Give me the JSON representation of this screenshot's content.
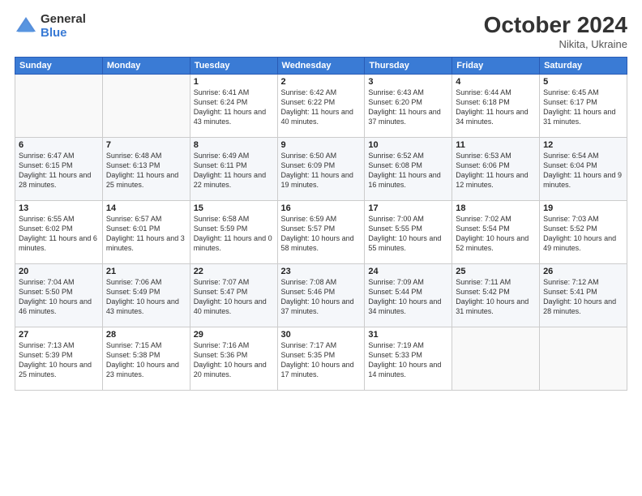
{
  "logo": {
    "general": "General",
    "blue": "Blue"
  },
  "title": "October 2024",
  "subtitle": "Nikita, Ukraine",
  "days": [
    "Sunday",
    "Monday",
    "Tuesday",
    "Wednesday",
    "Thursday",
    "Friday",
    "Saturday"
  ],
  "weeks": [
    [
      {
        "day": "",
        "content": ""
      },
      {
        "day": "",
        "content": ""
      },
      {
        "day": "1",
        "content": "Sunrise: 6:41 AM\nSunset: 6:24 PM\nDaylight: 11 hours and 43 minutes."
      },
      {
        "day": "2",
        "content": "Sunrise: 6:42 AM\nSunset: 6:22 PM\nDaylight: 11 hours and 40 minutes."
      },
      {
        "day": "3",
        "content": "Sunrise: 6:43 AM\nSunset: 6:20 PM\nDaylight: 11 hours and 37 minutes."
      },
      {
        "day": "4",
        "content": "Sunrise: 6:44 AM\nSunset: 6:18 PM\nDaylight: 11 hours and 34 minutes."
      },
      {
        "day": "5",
        "content": "Sunrise: 6:45 AM\nSunset: 6:17 PM\nDaylight: 11 hours and 31 minutes."
      }
    ],
    [
      {
        "day": "6",
        "content": "Sunrise: 6:47 AM\nSunset: 6:15 PM\nDaylight: 11 hours and 28 minutes."
      },
      {
        "day": "7",
        "content": "Sunrise: 6:48 AM\nSunset: 6:13 PM\nDaylight: 11 hours and 25 minutes."
      },
      {
        "day": "8",
        "content": "Sunrise: 6:49 AM\nSunset: 6:11 PM\nDaylight: 11 hours and 22 minutes."
      },
      {
        "day": "9",
        "content": "Sunrise: 6:50 AM\nSunset: 6:09 PM\nDaylight: 11 hours and 19 minutes."
      },
      {
        "day": "10",
        "content": "Sunrise: 6:52 AM\nSunset: 6:08 PM\nDaylight: 11 hours and 16 minutes."
      },
      {
        "day": "11",
        "content": "Sunrise: 6:53 AM\nSunset: 6:06 PM\nDaylight: 11 hours and 12 minutes."
      },
      {
        "day": "12",
        "content": "Sunrise: 6:54 AM\nSunset: 6:04 PM\nDaylight: 11 hours and 9 minutes."
      }
    ],
    [
      {
        "day": "13",
        "content": "Sunrise: 6:55 AM\nSunset: 6:02 PM\nDaylight: 11 hours and 6 minutes."
      },
      {
        "day": "14",
        "content": "Sunrise: 6:57 AM\nSunset: 6:01 PM\nDaylight: 11 hours and 3 minutes."
      },
      {
        "day": "15",
        "content": "Sunrise: 6:58 AM\nSunset: 5:59 PM\nDaylight: 11 hours and 0 minutes."
      },
      {
        "day": "16",
        "content": "Sunrise: 6:59 AM\nSunset: 5:57 PM\nDaylight: 10 hours and 58 minutes."
      },
      {
        "day": "17",
        "content": "Sunrise: 7:00 AM\nSunset: 5:55 PM\nDaylight: 10 hours and 55 minutes."
      },
      {
        "day": "18",
        "content": "Sunrise: 7:02 AM\nSunset: 5:54 PM\nDaylight: 10 hours and 52 minutes."
      },
      {
        "day": "19",
        "content": "Sunrise: 7:03 AM\nSunset: 5:52 PM\nDaylight: 10 hours and 49 minutes."
      }
    ],
    [
      {
        "day": "20",
        "content": "Sunrise: 7:04 AM\nSunset: 5:50 PM\nDaylight: 10 hours and 46 minutes."
      },
      {
        "day": "21",
        "content": "Sunrise: 7:06 AM\nSunset: 5:49 PM\nDaylight: 10 hours and 43 minutes."
      },
      {
        "day": "22",
        "content": "Sunrise: 7:07 AM\nSunset: 5:47 PM\nDaylight: 10 hours and 40 minutes."
      },
      {
        "day": "23",
        "content": "Sunrise: 7:08 AM\nSunset: 5:46 PM\nDaylight: 10 hours and 37 minutes."
      },
      {
        "day": "24",
        "content": "Sunrise: 7:09 AM\nSunset: 5:44 PM\nDaylight: 10 hours and 34 minutes."
      },
      {
        "day": "25",
        "content": "Sunrise: 7:11 AM\nSunset: 5:42 PM\nDaylight: 10 hours and 31 minutes."
      },
      {
        "day": "26",
        "content": "Sunrise: 7:12 AM\nSunset: 5:41 PM\nDaylight: 10 hours and 28 minutes."
      }
    ],
    [
      {
        "day": "27",
        "content": "Sunrise: 7:13 AM\nSunset: 5:39 PM\nDaylight: 10 hours and 25 minutes."
      },
      {
        "day": "28",
        "content": "Sunrise: 7:15 AM\nSunset: 5:38 PM\nDaylight: 10 hours and 23 minutes."
      },
      {
        "day": "29",
        "content": "Sunrise: 7:16 AM\nSunset: 5:36 PM\nDaylight: 10 hours and 20 minutes."
      },
      {
        "day": "30",
        "content": "Sunrise: 7:17 AM\nSunset: 5:35 PM\nDaylight: 10 hours and 17 minutes."
      },
      {
        "day": "31",
        "content": "Sunrise: 7:19 AM\nSunset: 5:33 PM\nDaylight: 10 hours and 14 minutes."
      },
      {
        "day": "",
        "content": ""
      },
      {
        "day": "",
        "content": ""
      }
    ]
  ]
}
